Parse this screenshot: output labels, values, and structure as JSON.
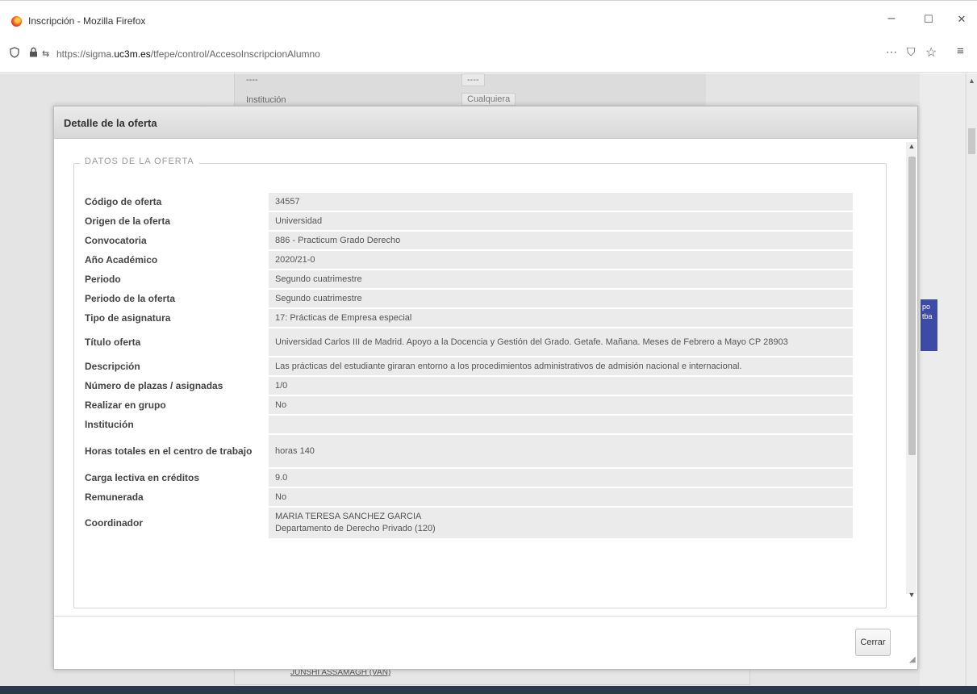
{
  "window": {
    "title": "Inscripción - Mozilla Firefox",
    "minimize": "–",
    "maximize": "☐",
    "close": "✕"
  },
  "address_bar": {
    "url_prefix": "https://sigma.",
    "url_domain": "uc3m.es",
    "url_path": "/tfepe/control/AccesoInscripcionAlumno",
    "more_icon": "⋯",
    "pocket_icon": "⛉",
    "star_icon": "☆",
    "menu_icon": "≡"
  },
  "background_page": {
    "row1_label": "----",
    "row1_select": "----",
    "row2_label": "Institución",
    "row2_select": "Cualquiera",
    "side_badge": "po tba",
    "bottom_link": "JUNSHI ASSAMAGH (VAN)"
  },
  "modal": {
    "title": "Detalle de la oferta",
    "legend": "DATOS DE LA OFERTA",
    "close_button": "Cerrar",
    "fields": [
      {
        "label": "Código de oferta",
        "value": "34557"
      },
      {
        "label": "Origen de la oferta",
        "value": "Universidad"
      },
      {
        "label": "Convocatoria",
        "value": "886 - Practicum Grado Derecho"
      },
      {
        "label": "Año Académico",
        "value": "2020/21-0"
      },
      {
        "label": "Periodo",
        "value": "Segundo cuatrimestre"
      },
      {
        "label": "Periodo de la oferta",
        "value": "Segundo cuatrimestre"
      },
      {
        "label": "Tipo de asignatura",
        "value": "17: Prácticas de Empresa especial"
      },
      {
        "label": "Título oferta",
        "value": "Universidad Carlos III de Madrid. Apoyo a la Docencia y Gestión del Grado. Getafe. Mañana. Meses de Febrero a Mayo CP 28903"
      },
      {
        "label": "Descripción",
        "value": "Las prácticas del estudiante giraran entorno a los procedimientos administrativos de admisión nacional e internacional."
      },
      {
        "label": "Número de plazas / asignadas",
        "value": "1/0"
      },
      {
        "label": "Realizar en grupo",
        "value": "No"
      },
      {
        "label": "Institución",
        "value": ""
      },
      {
        "label": "Horas totales en el centro de trabajo",
        "value": "horas 140"
      },
      {
        "label": "Carga lectiva en créditos",
        "value": "9.0"
      },
      {
        "label": "Remunerada",
        "value": "No"
      }
    ],
    "coordinator": {
      "label": "Coordinador",
      "name": "MARIA TERESA SANCHEZ GARCIA",
      "department": "Departamento de Derecho Privado (120)"
    }
  }
}
